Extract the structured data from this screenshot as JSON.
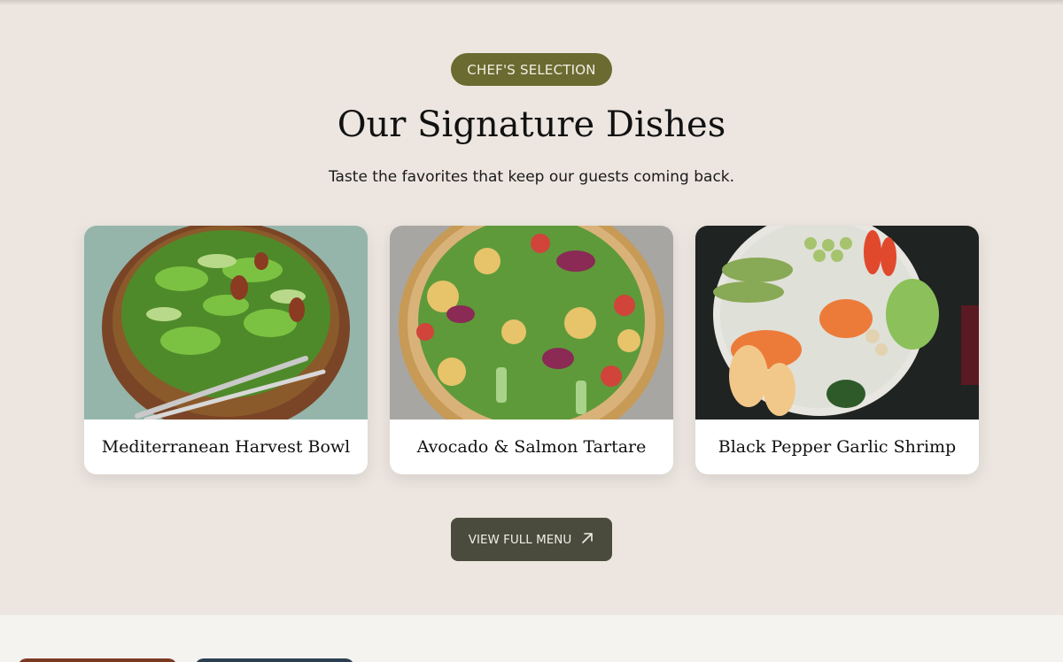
{
  "section": {
    "badge": "CHEF'S SELECTION",
    "title": "Our Signature Dishes",
    "subtitle": "Taste the favorites that keep our guests coming back."
  },
  "dishes": [
    {
      "name": "Mediterranean Harvest Bowl",
      "image_icon": "salad-bowl-image"
    },
    {
      "name": "Avocado & Salmon Tartare",
      "image_icon": "salad-bowl-image"
    },
    {
      "name": "Black Pepper Garlic Shrimp",
      "image_icon": "poke-bowl-image"
    }
  ],
  "cta": {
    "label": "VIEW FULL MENU",
    "icon": "arrow-up-right-icon"
  },
  "colors": {
    "background": "#ede6e0",
    "badge": "#6b6a30",
    "button": "#4a4b3d",
    "card": "#ffffff",
    "footer": "#f4f3f0"
  }
}
